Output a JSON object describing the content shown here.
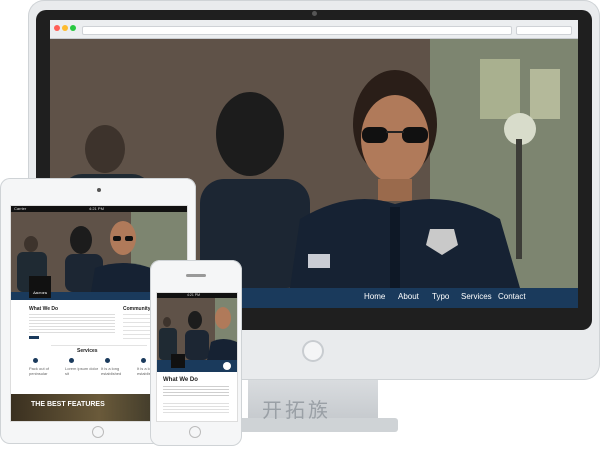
{
  "desktop": {
    "nav": [
      "Home",
      "About",
      "Typo",
      "Services",
      "Contact"
    ]
  },
  "tablet": {
    "status_left": "Carrier",
    "status_time": "4:21 PM",
    "logo_text": "Aurora",
    "section_title": "What We Do",
    "sidebar_title": "Community",
    "services_title": "Services",
    "service_items": [
      "Pack out of peninsular",
      "Lorem ipsum dolor sit",
      "It is a long established",
      "It is a long established"
    ],
    "features_banner": "THE BEST FEATURES"
  },
  "phone": {
    "status_time": "4:21 PM",
    "section_title": "What We Do"
  },
  "watermark": "开拓族",
  "colors": {
    "nav": "#1a3a5c",
    "bezel": "#1f1f1f"
  }
}
